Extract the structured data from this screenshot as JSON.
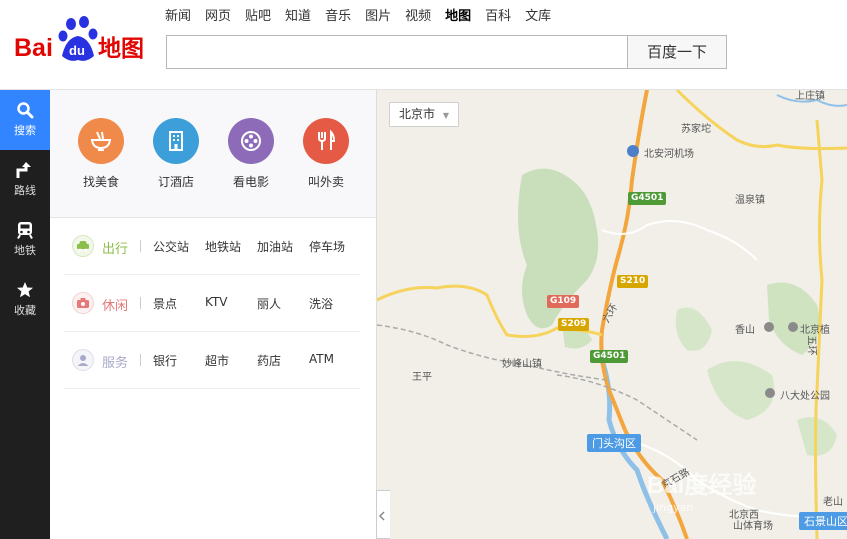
{
  "header": {
    "logo": {
      "bai": "Bai",
      "du": "du",
      "suffix": "地图"
    },
    "nav": [
      "新闻",
      "网页",
      "贴吧",
      "知道",
      "音乐",
      "图片",
      "视频",
      "地图",
      "百科",
      "文库"
    ],
    "active_nav": "地图",
    "search_value": "",
    "search_button": "百度一下"
  },
  "sidebar": {
    "items": [
      {
        "label": "搜索",
        "icon": "search-icon"
      },
      {
        "label": "路线",
        "icon": "route-icon"
      },
      {
        "label": "地铁",
        "icon": "subway-icon"
      },
      {
        "label": "收藏",
        "icon": "star-icon"
      }
    ]
  },
  "panel": {
    "quick": [
      {
        "label": "找美食",
        "icon": "noodle-bowl-icon",
        "color": "#f08a4b"
      },
      {
        "label": "订酒店",
        "icon": "hotel-building-icon",
        "color": "#3d9fd9"
      },
      {
        "label": "看电影",
        "icon": "film-reel-icon",
        "color": "#8d6bb8"
      },
      {
        "label": "叫外卖",
        "icon": "fork-knife-icon",
        "color": "#e55a45"
      }
    ],
    "categories": [
      {
        "name": "出行",
        "color": "#8bbe4a",
        "icon": "car-icon",
        "links": [
          "公交站",
          "地铁站",
          "加油站",
          "停车场"
        ]
      },
      {
        "name": "休闲",
        "color": "#e57a7a",
        "icon": "camera-icon",
        "links": [
          "景点",
          "KTV",
          "丽人",
          "洗浴"
        ]
      },
      {
        "name": "服务",
        "color": "#a9a9c9",
        "icon": "service-icon",
        "links": [
          "银行",
          "超市",
          "药店",
          "ATM"
        ]
      }
    ]
  },
  "map": {
    "city": "北京市",
    "labels": {
      "suJiaTuo": "苏家坨",
      "beianhe": "北安河机场",
      "wenquan": "温泉镇",
      "shangzhuang": "上庄镇",
      "xiangshan": "香山",
      "beijingzhi": "北京植",
      "badachu": "八大处公园",
      "miaofengshan": "妙峰山镇",
      "wangping": "王平",
      "liuhuan": "六环",
      "wuhuan": "五环",
      "laoshan": "老山",
      "tiyuchang": "山体育场",
      "beijingxi": "北京西",
      "jingshi": "京石路",
      "jingyan": "jingyan"
    },
    "shields": {
      "g4501a": "G4501",
      "s210": "S210",
      "g109": "G109",
      "s209": "S209",
      "g4501b": "G4501"
    },
    "badges": {
      "mentougou": "门头沟区",
      "shijingshan": "石景山区"
    },
    "watermark": "Bai度经验"
  }
}
